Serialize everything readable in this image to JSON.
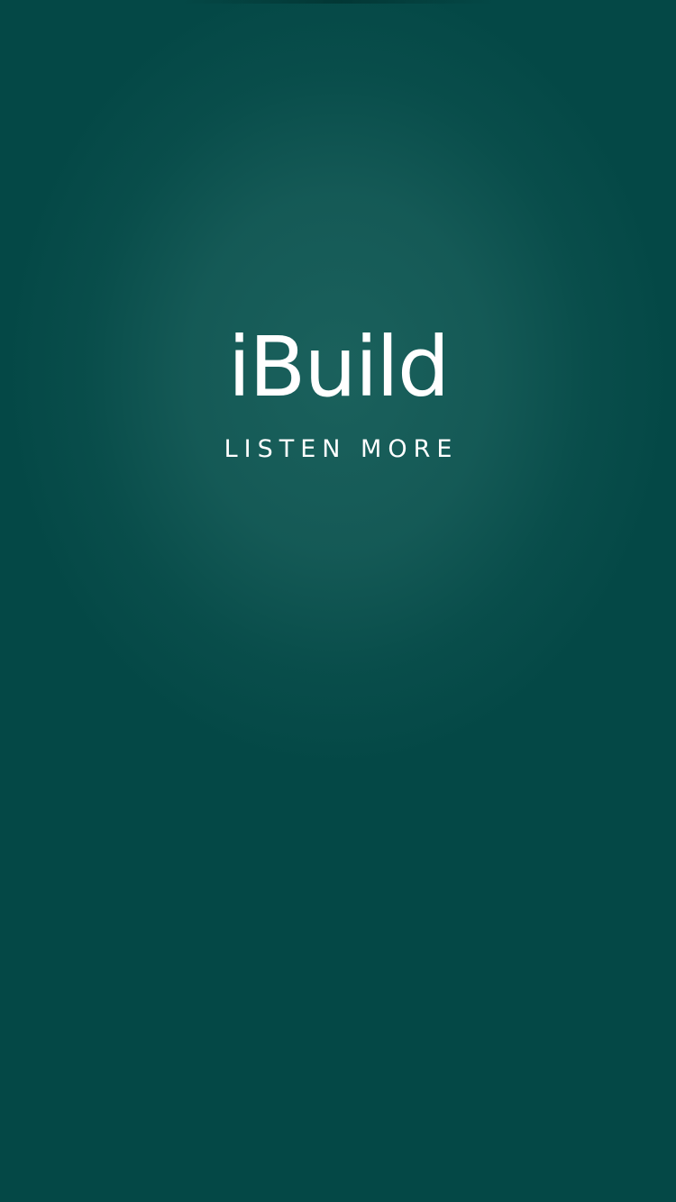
{
  "splash": {
    "app_title": "iBuild",
    "tagline": "LISTEN MORE"
  },
  "colors": {
    "background": "#044846",
    "glow": "#1e625d",
    "text": "#ffffff"
  }
}
